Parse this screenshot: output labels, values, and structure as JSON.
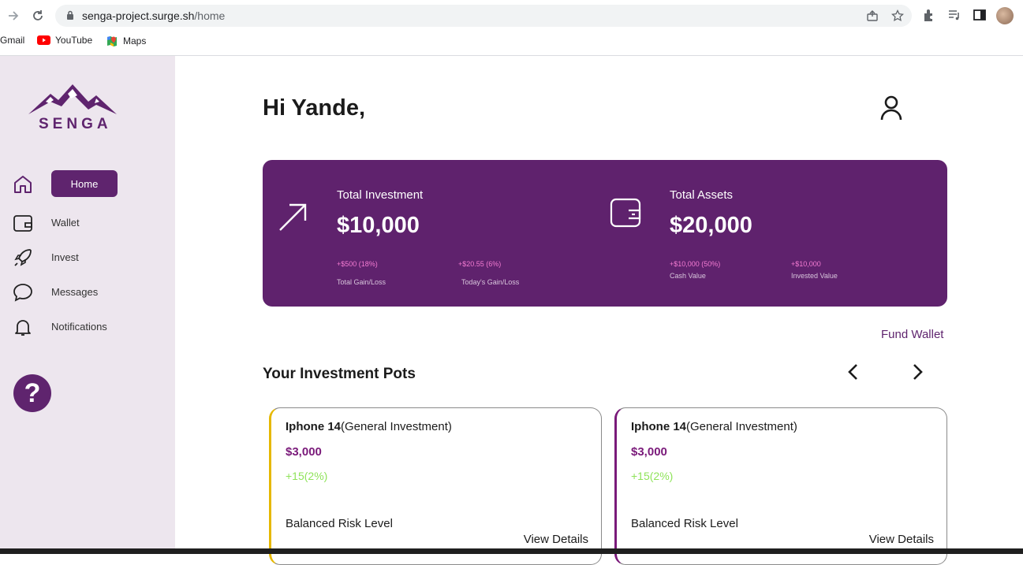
{
  "browser": {
    "url_host": "senga-project.surge.sh",
    "url_path": "/home",
    "bookmarks": [
      {
        "label": "Gmail",
        "icon": "gmail-icon"
      },
      {
        "label": "YouTube",
        "icon": "youtube-icon"
      },
      {
        "label": "Maps",
        "icon": "maps-icon"
      }
    ]
  },
  "sidebar": {
    "logo_text": "SENGA",
    "items": [
      {
        "label": "Home",
        "icon": "home-icon",
        "active": true
      },
      {
        "label": "Wallet",
        "icon": "wallet-icon"
      },
      {
        "label": "Invest",
        "icon": "rocket-icon"
      },
      {
        "label": "Messages",
        "icon": "chat-bubble-icon"
      },
      {
        "label": "Notifications",
        "icon": "bell-icon"
      }
    ],
    "help_label": "?"
  },
  "header": {
    "greeting": "Hi Yande,"
  },
  "summary": {
    "investment": {
      "title": "Total Investment",
      "value": "$10,000",
      "stat1": "+$500 (18%)",
      "cap1": "Total Gain/Loss",
      "stat2": "+$20.55 (6%)",
      "cap2": "Today's Gain/Loss"
    },
    "assets": {
      "title": "Total Assets",
      "value": "$20,000",
      "stat1": "+$10,000 (50%)",
      "cap1": "Cash Value",
      "stat2": "+$10,000",
      "cap2": "Invested Value"
    },
    "colors": {
      "card": "#5f226d",
      "stat": "#f47bd2"
    }
  },
  "fund_wallet": "Fund Wallet",
  "pots": {
    "title": "Your Investment Pots",
    "items": [
      {
        "name": "Iphone 14",
        "type": "(General Investment)",
        "amount": "$3,000",
        "change": "+15(2%)",
        "risk": "Balanced Risk Level",
        "details": "View Details",
        "accent": "#e6b800"
      },
      {
        "name": "Iphone 14",
        "type": "(General Investment)",
        "amount": "$3,000",
        "change": "+15(2%)",
        "risk": "Balanced Risk Level",
        "details": "View Details",
        "accent": "#7a1a7a"
      }
    ]
  }
}
